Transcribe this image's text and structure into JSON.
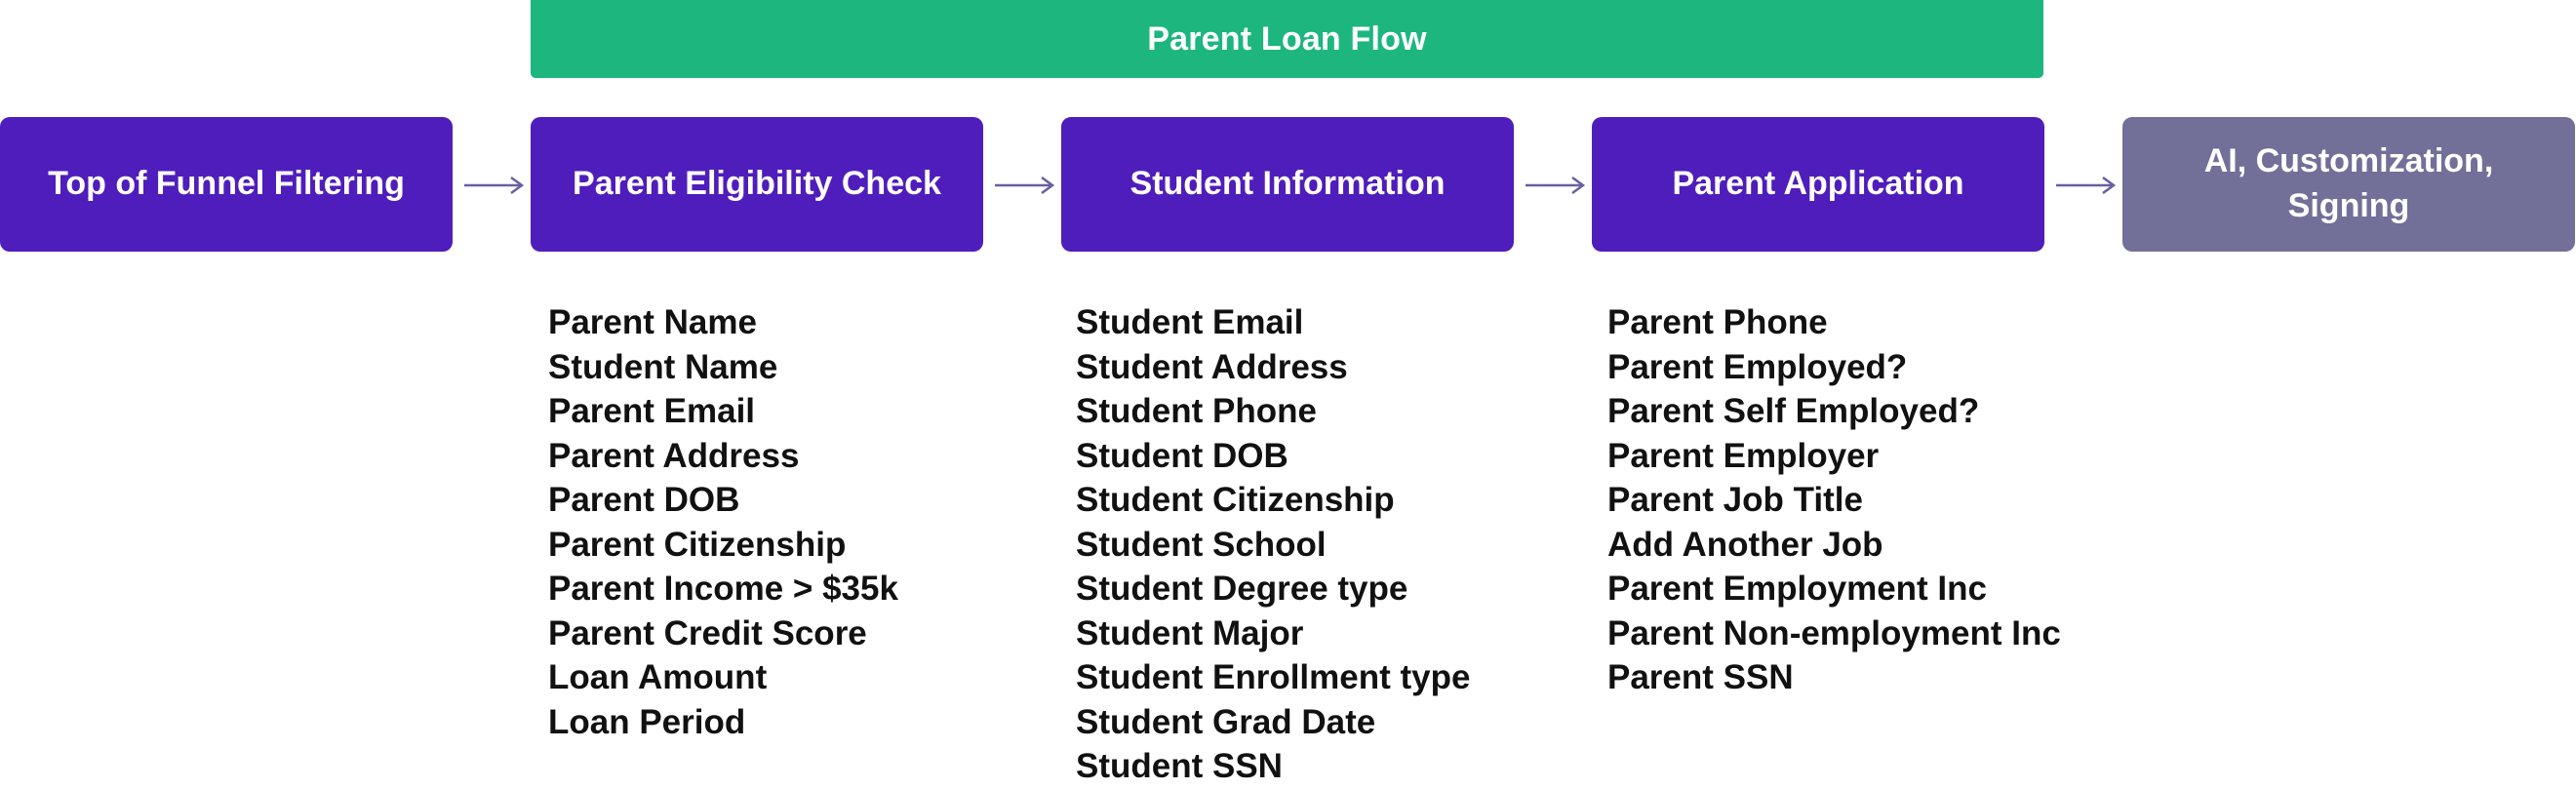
{
  "banner": {
    "label": "Parent Loan Flow",
    "color": "#1db67f"
  },
  "colors": {
    "step_primary": "#4f1dbb",
    "step_muted": "#727098",
    "arrow": "#6a5fa0",
    "text": "#111111"
  },
  "steps": [
    {
      "label": "Top of Funnel Filtering"
    },
    {
      "label": "Parent Eligibility Check"
    },
    {
      "label": "Student Information"
    },
    {
      "label": "Parent Application"
    },
    {
      "label": "AI, Customization, Signing"
    }
  ],
  "columns": [
    {
      "fields": [
        "Parent Name",
        "Student Name",
        "Parent Email",
        "Parent Address",
        "Parent DOB",
        "Parent Citizenship",
        "Parent Income > $35k",
        "Parent Credit Score",
        "Loan Amount",
        "Loan Period"
      ]
    },
    {
      "fields": [
        "Student Email",
        "Student Address",
        "Student Phone",
        "Student DOB",
        "Student Citizenship",
        "Student School",
        "Student Degree type",
        "Student Major",
        "Student Enrollment type",
        "Student Grad Date",
        "Student SSN"
      ]
    },
    {
      "fields": [
        "Parent Phone",
        "Parent Employed?",
        "Parent Self Employed?",
        "Parent Employer",
        "Parent Job Title",
        "Add Another Job",
        "Parent Employment Inc",
        "Parent Non-employment Inc",
        "Parent SSN"
      ]
    }
  ]
}
